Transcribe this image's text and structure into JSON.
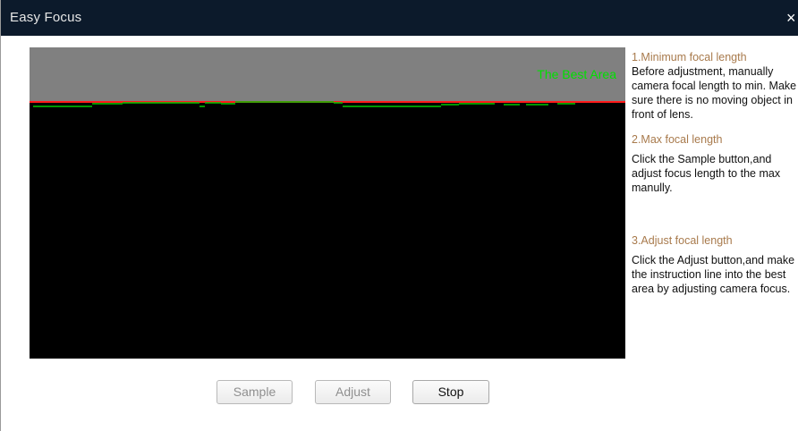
{
  "window": {
    "title": "Easy Focus",
    "close_glyph": "×"
  },
  "scope": {
    "best_area_label": "The Best Area",
    "colors": {
      "background": "#000000",
      "best_band": "#808080",
      "threshold_line": "#ff1a1a",
      "trace": "#00c800",
      "label": "#00e000"
    }
  },
  "instructions": {
    "step1_title": "1.Minimum focal length",
    "step1_text": "Before adjustment, manually camera focal length to min. Make sure there is no moving object in front of lens.",
    "step2_title": "2.Max focal length",
    "step2_text": "Click the Sample button,and adjust focus length to the max manully.",
    "step3_title": "3.Adjust focal length",
    "step3_text": "Click the Adjust button,and make the instruction line into the best area by adjusting camera focus."
  },
  "buttons": {
    "sample": {
      "label": "Sample",
      "enabled": false
    },
    "adjust": {
      "label": "Adjust",
      "enabled": false
    },
    "stop": {
      "label": "Stop",
      "enabled": true
    }
  }
}
